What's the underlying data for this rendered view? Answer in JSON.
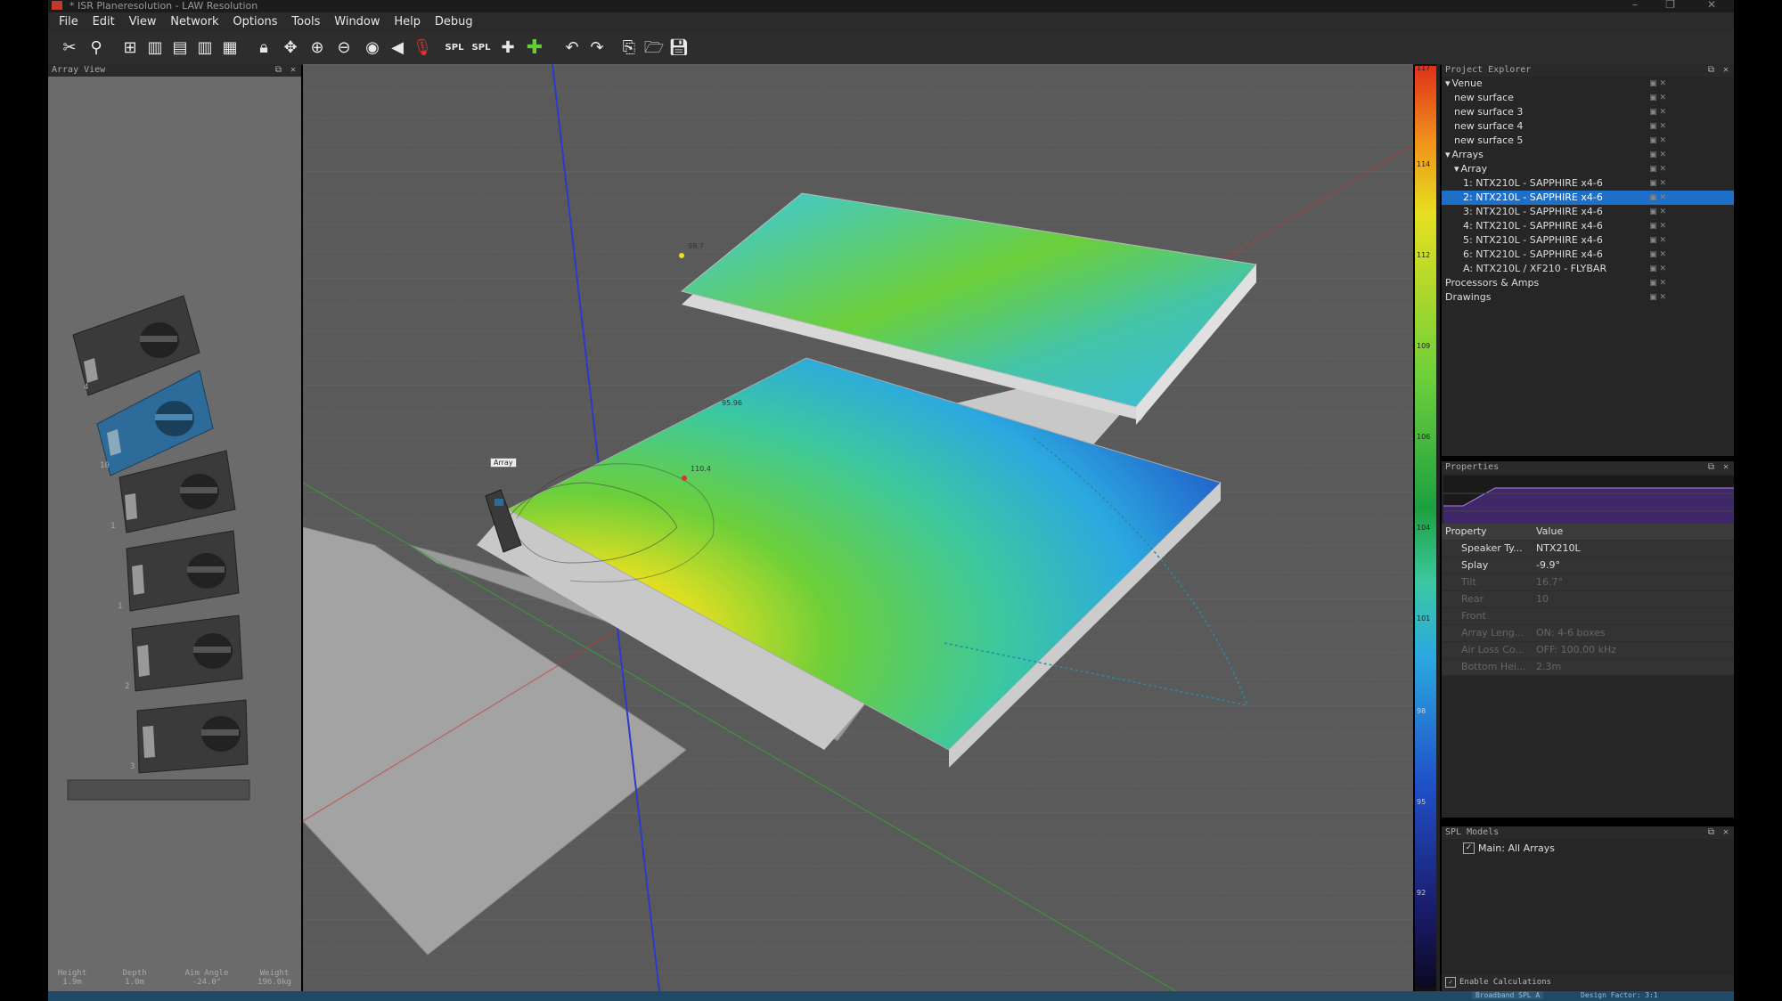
{
  "window": {
    "title": "* ISR Planeresolution - LAW Resolution"
  },
  "menu": [
    "File",
    "Edit",
    "View",
    "Network",
    "Options",
    "Tools",
    "Window",
    "Help",
    "Debug"
  ],
  "panels": {
    "array_view": "Array View",
    "project_explorer": "Project Explorer",
    "properties": "Properties",
    "spl_models": "SPL Models"
  },
  "array_view": {
    "box_labels": [
      "4",
      "10",
      "1",
      "1",
      "2",
      "3"
    ],
    "footer": [
      {
        "label": "Height",
        "value": "1.9m"
      },
      {
        "label": "Depth",
        "value": "1.0m"
      },
      {
        "label": "Aim Angle",
        "value": "-24.0°"
      },
      {
        "label": "Weight",
        "value": "196.0kg"
      }
    ]
  },
  "viewport": {
    "array_tag": "Array",
    "marker_upper": "98.7",
    "marker_lower": "110.4",
    "marker_mid": "95.96"
  },
  "scale": {
    "ticks": [
      "117",
      "114",
      "112",
      "109",
      "106",
      "104",
      "101",
      "98",
      "95",
      "92"
    ]
  },
  "project_tree": [
    {
      "label": "Venue",
      "level": 0,
      "expander": "▾"
    },
    {
      "label": "new surface",
      "level": 1
    },
    {
      "label": "new surface 3",
      "level": 1
    },
    {
      "label": "new surface 4",
      "level": 1
    },
    {
      "label": "new surface 5",
      "level": 1
    },
    {
      "label": "Arrays",
      "level": 0,
      "expander": "▾"
    },
    {
      "label": "Array",
      "level": 1,
      "expander": "▾"
    },
    {
      "label": "1: NTX210L - SAPPHIRE x4-6",
      "level": 2
    },
    {
      "label": "2: NTX210L - SAPPHIRE x4-6",
      "level": 2,
      "selected": true
    },
    {
      "label": "3: NTX210L - SAPPHIRE x4-6",
      "level": 2
    },
    {
      "label": "4: NTX210L - SAPPHIRE x4-6",
      "level": 2
    },
    {
      "label": "5: NTX210L - SAPPHIRE x4-6",
      "level": 2
    },
    {
      "label": "6: NTX210L - SAPPHIRE x4-6",
      "level": 2
    },
    {
      "label": "A: NTX210L / XF210 - FLYBAR",
      "level": 2
    },
    {
      "label": "Processors & Amps",
      "level": 0
    },
    {
      "label": "Drawings",
      "level": 0
    }
  ],
  "properties": {
    "header": {
      "property": "Property",
      "value": "Value"
    },
    "rows": [
      {
        "k": "Speaker Ty...",
        "v": "NTX210L",
        "dim": false
      },
      {
        "k": "Splay",
        "v": "-9.9°",
        "dim": false
      },
      {
        "k": "Tilt",
        "v": "16.7°",
        "dim": true
      },
      {
        "k": "Rear",
        "v": "10",
        "dim": true
      },
      {
        "k": "Front",
        "v": "",
        "dim": true
      },
      {
        "k": "Array Leng...",
        "v": "ON: 4-6 boxes",
        "dim": true
      },
      {
        "k": "Air Loss Co...",
        "v": "OFF: 100.00 kHz",
        "dim": true
      },
      {
        "k": "Bottom Hei...",
        "v": "2.3m",
        "dim": true
      }
    ]
  },
  "spl_models": {
    "item": "Main: All Arrays",
    "checked": true
  },
  "footer": {
    "enable_calculations": "Enable Calculations",
    "broadband": "Broadband SPL A",
    "design_factor": "Design Factor: 3:1"
  }
}
